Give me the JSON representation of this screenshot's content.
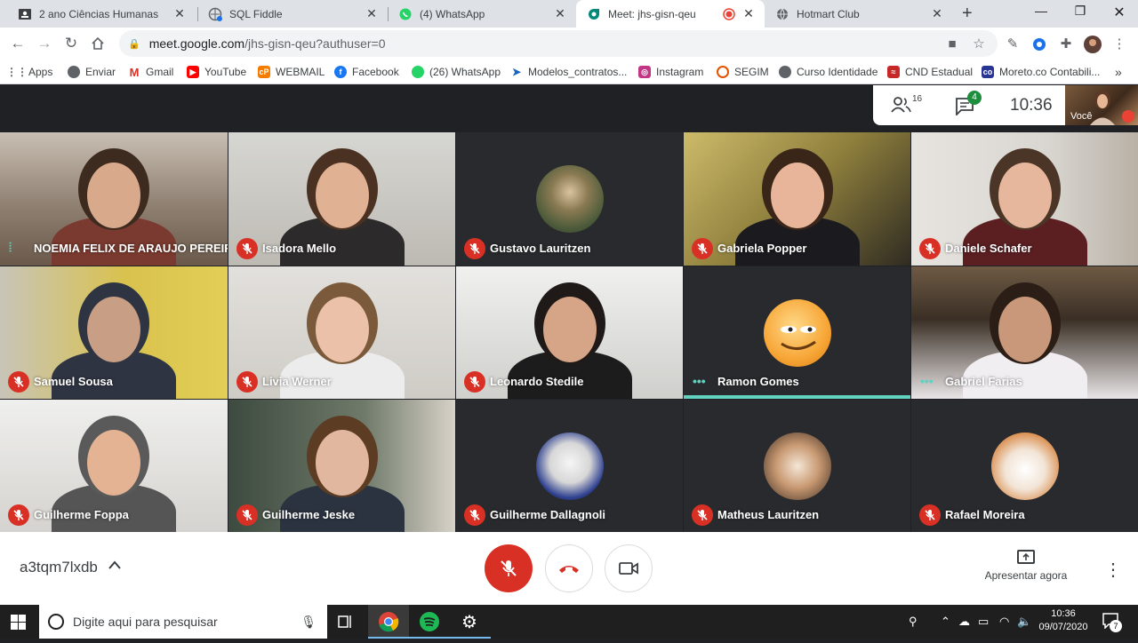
{
  "tabs": [
    {
      "title": "2 ano Ciências Humanas",
      "icon": "classroom-icon"
    },
    {
      "title": "SQL Fiddle",
      "icon": "sqlfiddle-icon"
    },
    {
      "title": "(4) WhatsApp",
      "icon": "whatsapp-icon"
    },
    {
      "title": "Meet: jhs-gisn-qeu",
      "icon": "meet-icon"
    },
    {
      "title": "Hotmart Club",
      "icon": "globe-icon"
    }
  ],
  "address": {
    "host": "meet.google.com",
    "path": "/jhs-gisn-qeu?authuser=0"
  },
  "bookmarks": [
    {
      "label": "Apps",
      "icon": "apps-grid-icon",
      "color": "#5f6368"
    },
    {
      "label": "Enviar",
      "icon": "globe-icon",
      "color": "#5f6368"
    },
    {
      "label": "Gmail",
      "icon": "gmail-icon",
      "color": "#d93025"
    },
    {
      "label": "YouTube",
      "icon": "youtube-icon",
      "color": "#ff0000"
    },
    {
      "label": "WEBMAIL",
      "icon": "webmail-icon",
      "color": "#f57c00"
    },
    {
      "label": "Facebook",
      "icon": "facebook-icon",
      "color": "#1877f2"
    },
    {
      "label": "(26) WhatsApp",
      "icon": "whatsapp-icon",
      "color": "#25d366"
    },
    {
      "label": "Modelos_contratos...",
      "icon": "bird-icon",
      "color": "#1565c0"
    },
    {
      "label": "Instagram",
      "icon": "instagram-icon",
      "color": "#c13584"
    },
    {
      "label": "SEGIM",
      "icon": "segim-icon",
      "color": "#e65100"
    },
    {
      "label": "Curso Identidade",
      "icon": "globe-icon",
      "color": "#5f6368"
    },
    {
      "label": "CND Estadual",
      "icon": "cnd-icon",
      "color": "#c62828"
    },
    {
      "label": "Moreto.co Contabili...",
      "icon": "moreto-icon",
      "color": "#283593"
    }
  ],
  "meet_info": {
    "participants_count": "16",
    "chat_badge": "4",
    "time": "10:36"
  },
  "self_view": {
    "label": "Você"
  },
  "participants": [
    {
      "name": "NOEMIA FELIX DE ARAUJO PEREIRA",
      "state": "speaking"
    },
    {
      "name": "Isadora Mello",
      "state": "muted"
    },
    {
      "name": "Gustavo Lauritzen",
      "state": "muted"
    },
    {
      "name": "Gabriela Popper",
      "state": "muted"
    },
    {
      "name": "Daniele Schafer",
      "state": "muted"
    },
    {
      "name": "Samuel Sousa",
      "state": "muted"
    },
    {
      "name": "Livia Werner",
      "state": "muted"
    },
    {
      "name": "Leonardo Stedile",
      "state": "muted"
    },
    {
      "name": "Ramon Gomes",
      "state": "speaking"
    },
    {
      "name": "Gabriel Farias",
      "state": "speaking"
    },
    {
      "name": "Guilherme Foppa",
      "state": "muted"
    },
    {
      "name": "Guilherme Jeske",
      "state": "muted"
    },
    {
      "name": "Guilherme Dallagnoli",
      "state": "muted"
    },
    {
      "name": "Matheus Lauritzen",
      "state": "muted"
    },
    {
      "name": "Rafael Moreira",
      "state": "muted"
    }
  ],
  "bottom": {
    "meeting_code": "a3tqm7lxdb",
    "present_label": "Apresentar agora"
  },
  "taskbar": {
    "search_placeholder": "Digite aqui para pesquisar",
    "time": "10:36",
    "date": "09/07/2020",
    "notification_count": "7"
  },
  "colors": {
    "mute_red": "#d93025",
    "speaking_teal": "#62d2c0",
    "meet_dark": "#202124"
  }
}
